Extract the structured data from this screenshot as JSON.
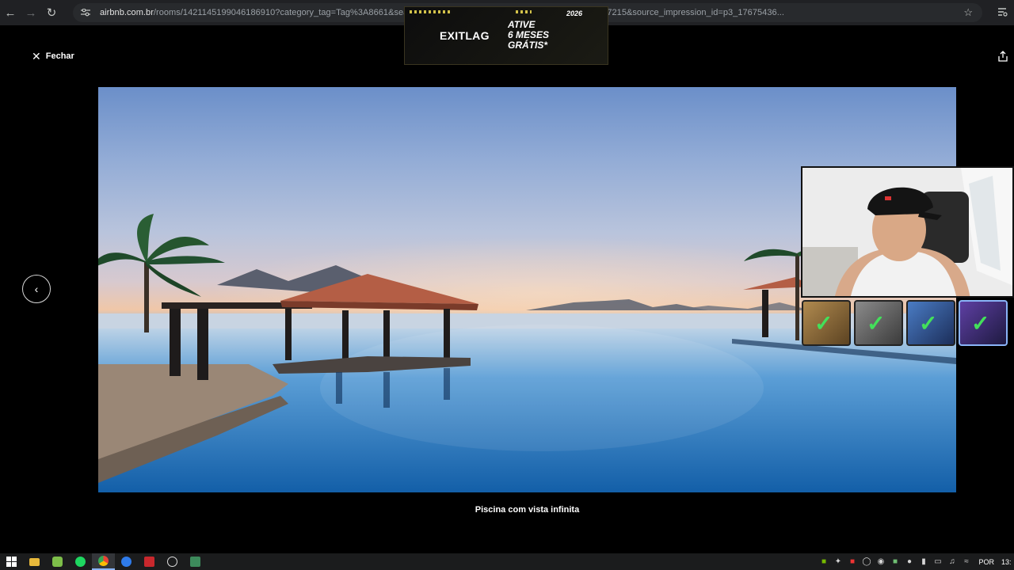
{
  "browser": {
    "url_host": "airbnb.com.br",
    "url_path": "/rooms/142114519904618691​0?category_tag=Tag%3A8661&search...06&check_out=2026-02-11&photo_id=2173937215&source_impression_id=p3_17675436..."
  },
  "viewer": {
    "close_label": "Fechar",
    "caption": "Piscina com vista infinita"
  },
  "ad": {
    "brand": "EXITLAG",
    "headline": "ATIVE\n6 MESES\nGRÁTIS*",
    "year": "2026"
  },
  "tiles": [
    {
      "name": "tile-1",
      "color": "#8a6a3a"
    },
    {
      "name": "tile-2",
      "color": "#5a5a5a"
    },
    {
      "name": "tile-3",
      "color": "#2c4f8a"
    },
    {
      "name": "tile-4",
      "color": "#3b2a6b"
    }
  ],
  "taskbar": {
    "apps": [
      "windows-start",
      "file-explorer",
      "android-app",
      "spotify",
      "chrome",
      "browser-blue",
      "news-app",
      "steam",
      "terminal"
    ],
    "tray_lang": "POR",
    "tray_clock": "13:"
  },
  "colors": {
    "browser_bar": "#202124",
    "accent_check": "#43e05a",
    "ad_gold": "#d3c24a"
  }
}
